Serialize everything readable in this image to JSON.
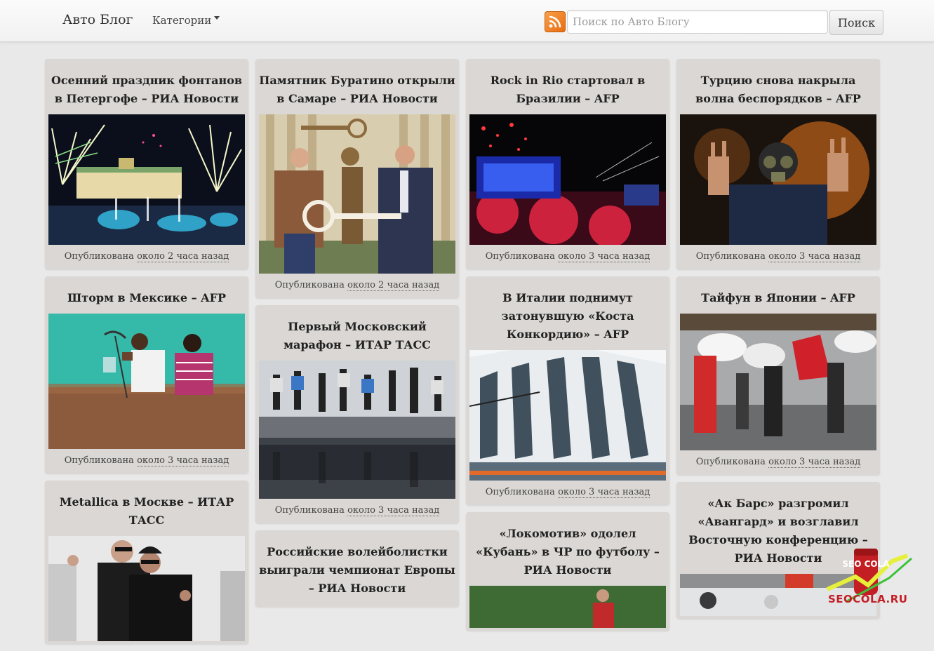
{
  "navbar": {
    "brand": "Авто Блог",
    "categories_label": "Категории",
    "search_placeholder": "Поиск по Авто Блогу",
    "search_button": "Поиск"
  },
  "published_prefix": "Опубликована",
  "columns": [
    [
      {
        "title": "Осенний праздник фонтанов в Петергофе – РИА Новости",
        "time": "около 2 часа назад"
      },
      {
        "title": "Шторм в Мексике – AFP",
        "time": "около 3 часа назад"
      },
      {
        "title": "Metallica в Москве – ИТАР ТАСС",
        "time": ""
      }
    ],
    [
      {
        "title": "Памятник Буратино открыли в Самаре – РИА Новости",
        "time": "около 2 часа назад"
      },
      {
        "title": "Первый Московский марафон – ИТАР ТАСС",
        "time": "около 3 часа назад"
      },
      {
        "title": "Российские волейболистки выиграли чемпионат Европы – РИА Новости",
        "time": ""
      }
    ],
    [
      {
        "title": "Rock in Rio стартовал в Бразилии – AFP",
        "time": "около 3 часа назад"
      },
      {
        "title": "В Италии поднимут затонувшую «Коста Конкордию» – AFP",
        "time": "около 3 часа назад"
      },
      {
        "title": "«Локомотив» одолел «Кубань» в ЧР по футболу – РИА Новости",
        "time": ""
      }
    ],
    [
      {
        "title": "Турцию снова накрыла волна беспорядков – AFP",
        "time": "около 3 часа назад"
      },
      {
        "title": "Тайфун в Японии – AFP",
        "time": "около 3 часа назад"
      },
      {
        "title": "«Ак Барс» разгромил «Авангард» и возглавил Восточную конференцию – РИА Новости",
        "time": ""
      }
    ]
  ],
  "watermark": {
    "badge": "SEO COLA",
    "text": "SEOCOLA.RU"
  },
  "colors": {
    "card_bg": "#dad7d4",
    "page_bg": "#e9e9e9",
    "rss": "#e86d10",
    "watermark": "#c41e25"
  }
}
